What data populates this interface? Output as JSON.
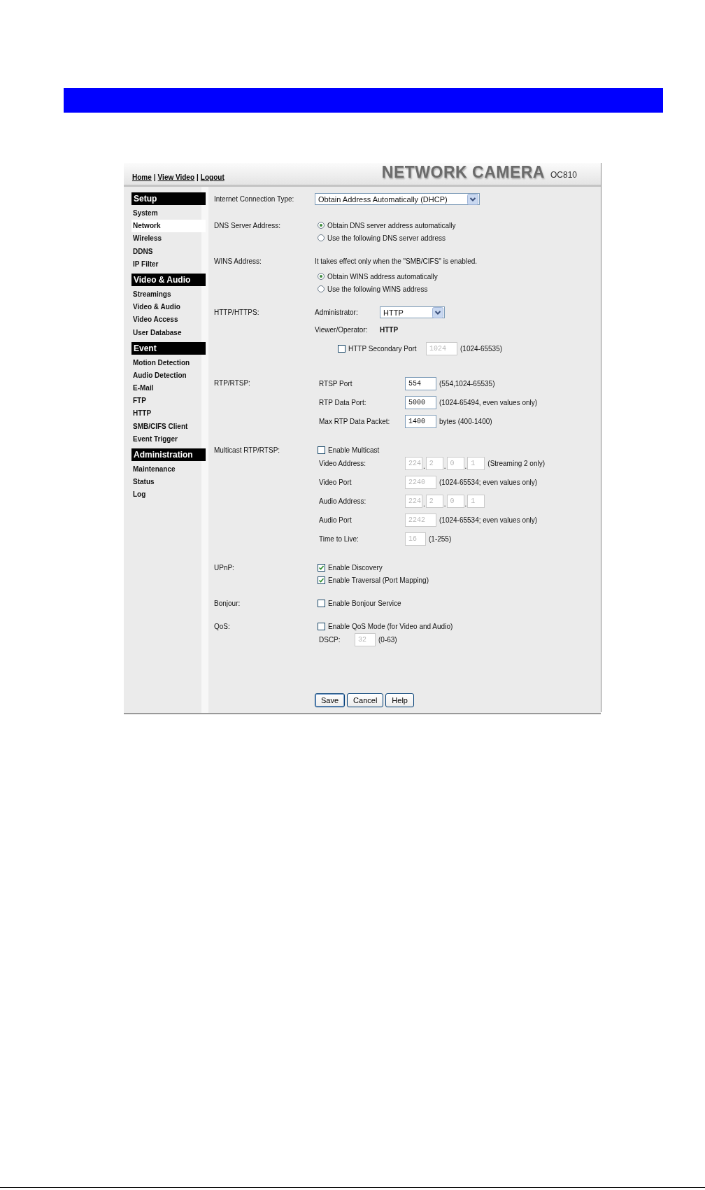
{
  "header": {
    "links": [
      "Home",
      "View Video",
      "Logout"
    ],
    "separator": "|",
    "brand": "NETWORK CAMERA",
    "model": "OC810"
  },
  "sidebar": {
    "sections": [
      {
        "title": "Setup",
        "items": [
          {
            "label": "System",
            "selected": false
          },
          {
            "label": "Network",
            "selected": true
          },
          {
            "label": "Wireless",
            "selected": false
          },
          {
            "label": "DDNS",
            "selected": false
          },
          {
            "label": "IP Filter",
            "selected": false
          }
        ]
      },
      {
        "title": "Video & Audio",
        "items": [
          {
            "label": "Streamings",
            "selected": false
          },
          {
            "label": "Video & Audio",
            "selected": false
          },
          {
            "label": "Video Access",
            "selected": false
          },
          {
            "label": "User Database",
            "selected": false
          }
        ]
      },
      {
        "title": "Event",
        "items": [
          {
            "label": "Motion Detection",
            "selected": false
          },
          {
            "label": "Audio Detection",
            "selected": false
          },
          {
            "label": "E-Mail",
            "selected": false
          },
          {
            "label": "FTP",
            "selected": false
          },
          {
            "label": "HTTP",
            "selected": false
          },
          {
            "label": "SMB/CIFS Client",
            "selected": false
          },
          {
            "label": "Event Trigger",
            "selected": false
          }
        ]
      },
      {
        "title": "Administration",
        "items": [
          {
            "label": "Maintenance",
            "selected": false
          },
          {
            "label": "Status",
            "selected": false
          },
          {
            "label": "Log",
            "selected": false
          }
        ]
      }
    ]
  },
  "form": {
    "sections": [
      {
        "label": "Internet Connection Type:",
        "rows": [
          {
            "kind": "select",
            "value": "Obtain Address Automatically (DHCP)"
          }
        ]
      },
      {
        "label": "DNS Server Address:",
        "rows": [
          {
            "kind": "radio",
            "label": "Obtain DNS server address automatically",
            "selected": true
          },
          {
            "kind": "radio",
            "label": "Use the following DNS server address",
            "selected": false
          }
        ]
      },
      {
        "label": "WINS Address:",
        "rows": [
          {
            "kind": "note",
            "text": "It takes effect only when the \"SMB/CIFS\" is enabled."
          },
          {
            "kind": "radio",
            "label": "Obtain WINS address automatically",
            "selected": true
          },
          {
            "kind": "radio",
            "label": "Use the following WINS address",
            "selected": false
          }
        ]
      },
      {
        "label": "HTTP/HTTPS:",
        "rows": [
          {
            "kind": "labeled-select",
            "label": "Administrator:",
            "value": "HTTP"
          },
          {
            "kind": "labeled-text",
            "label": "Viewer/Operator:",
            "value": "HTTP"
          },
          {
            "kind": "checkbox-input",
            "label": "HTTP Secondary Port",
            "checked": false,
            "value": "1024",
            "disabled": true,
            "hint": "(1024-65535)"
          }
        ]
      },
      {
        "label": "RTP/RTSP:",
        "rows": [
          {
            "kind": "input",
            "label": "RTSP Port",
            "value": "554",
            "disabled": false,
            "hint": "(554,1024-65535)"
          },
          {
            "kind": "input",
            "label": "RTP Data Port:",
            "value": "5000",
            "disabled": false,
            "hint": "(1024-65494, even values only)"
          },
          {
            "kind": "input",
            "label": "Max RTP Data Packet:",
            "value": "1400",
            "disabled": false,
            "hint": "bytes (400-1400)"
          }
        ]
      },
      {
        "label": "Multicast RTP/RTSP:",
        "rows": [
          {
            "kind": "checkbox",
            "label": "Enable Multicast",
            "checked": false
          },
          {
            "kind": "ip",
            "label": "Video Address:",
            "octets": [
              "224",
              "2",
              "0",
              "1"
            ],
            "separator": ".",
            "disabled": true,
            "hint": "(Streaming 2 only)"
          },
          {
            "kind": "input",
            "label": "Video Port",
            "value": "2240",
            "disabled": true,
            "hint": "(1024-65534; even values only)"
          },
          {
            "kind": "ip",
            "label": "Audio Address:",
            "octets": [
              "224",
              "2",
              "0",
              "1"
            ],
            "separator": ".",
            "disabled": true
          },
          {
            "kind": "input",
            "label": "Audio Port",
            "value": "2242",
            "disabled": true,
            "hint": "(1024-65534; even values only)"
          },
          {
            "kind": "short-input",
            "label": "Time to Live:",
            "value": "16",
            "disabled": true,
            "hint": "(1-255)"
          }
        ]
      },
      {
        "label": "UPnP:",
        "rows": [
          {
            "kind": "checkbox",
            "label": "Enable Discovery",
            "checked": true
          },
          {
            "kind": "checkbox",
            "label": "Enable Traversal (Port Mapping)",
            "checked": true
          }
        ]
      },
      {
        "label": "Bonjour:",
        "rows": [
          {
            "kind": "checkbox",
            "label": "Enable Bonjour Service",
            "checked": false
          }
        ]
      },
      {
        "label": "QoS:",
        "rows": [
          {
            "kind": "checkbox",
            "label": "Enable QoS Mode (for Video and Audio)",
            "checked": false
          },
          {
            "kind": "inline-input",
            "label": "DSCP:",
            "value": "32",
            "disabled": true,
            "hint": "(0-63)"
          }
        ]
      }
    ],
    "buttons": [
      {
        "label": "Save",
        "default": true
      },
      {
        "label": "Cancel",
        "default": false
      },
      {
        "label": "Help",
        "default": false
      }
    ]
  }
}
